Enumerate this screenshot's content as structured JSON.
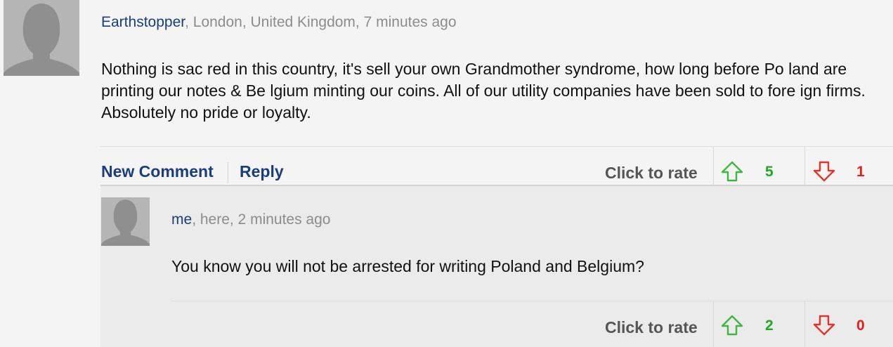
{
  "comment": {
    "author": "Earthstopper",
    "location_time": ", London, United Kingdom, 7 minutes ago",
    "text": "Nothing is sac red in this country, it's sell your own Grandmother syndrome, how long before Po land are printing our notes & Be lgium minting our coins. All of our utility companies have been sold to fore ign firms. Absolutely no pride or loyalty.",
    "actions": {
      "new_comment": "New Comment",
      "reply": "Reply"
    },
    "rating": {
      "label": "Click to rate",
      "up_count": "5",
      "down_count": "1"
    }
  },
  "reply": {
    "author": "me",
    "location_time": ", here, 2 minutes ago",
    "text": "You know you will not be arrested for writing Poland and Belgium?",
    "rating": {
      "label": "Click to rate",
      "up_count": "2",
      "down_count": "0"
    }
  },
  "colors": {
    "link": "#1a3d7c",
    "up": "#22a822",
    "down": "#e0221b",
    "meta": "#8c8c8c"
  },
  "icons": {
    "avatar": "default-avatar-silhouette",
    "up": "arrow-up-outline-icon",
    "down": "arrow-down-outline-icon"
  }
}
